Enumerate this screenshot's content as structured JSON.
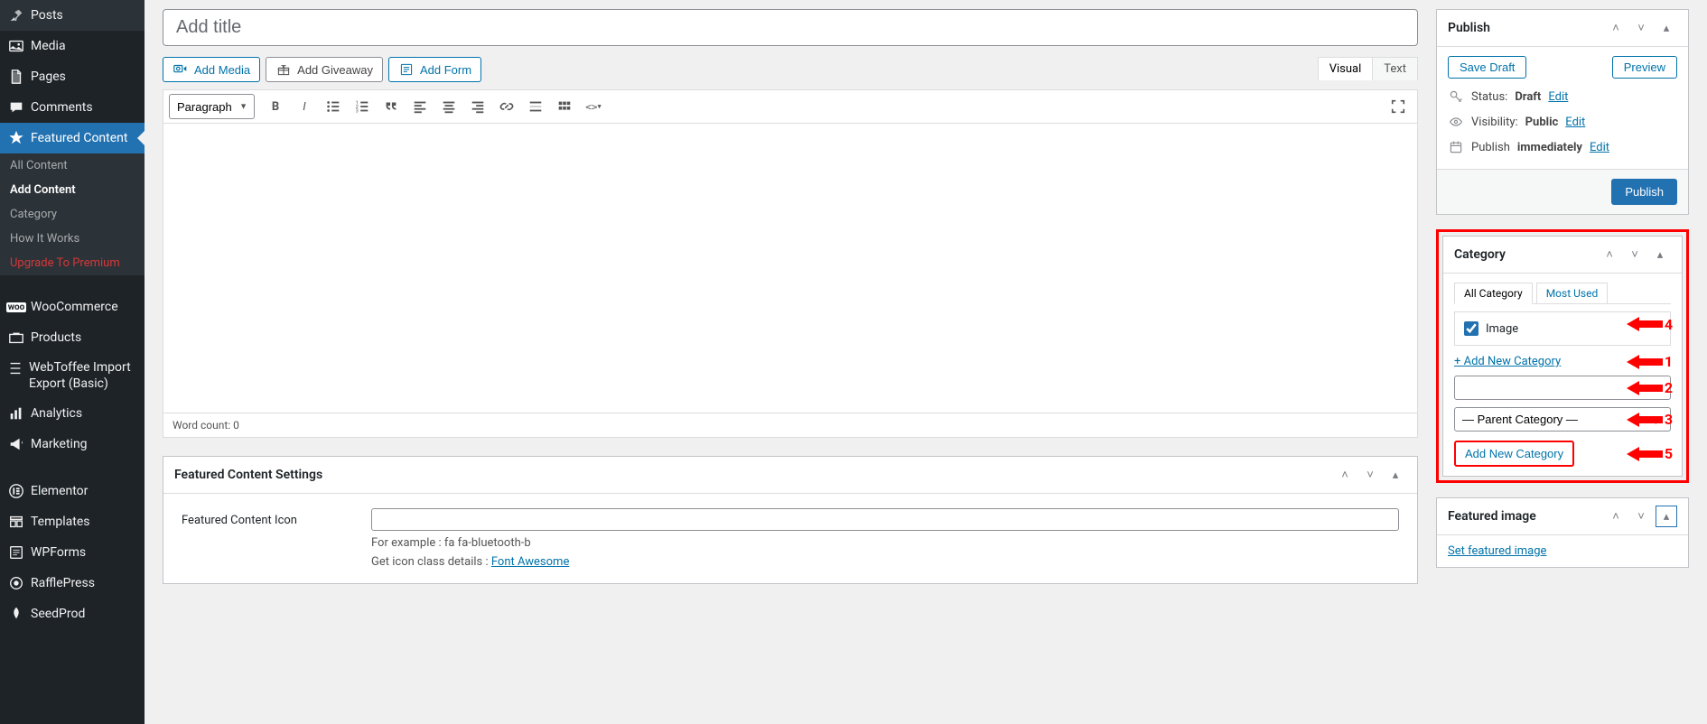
{
  "sidebar": {
    "items": [
      {
        "icon": "pin",
        "label": "Posts"
      },
      {
        "icon": "media",
        "label": "Media"
      },
      {
        "icon": "page",
        "label": "Pages"
      },
      {
        "icon": "comment",
        "label": "Comments"
      },
      {
        "icon": "star",
        "label": "Featured Content",
        "active": true
      },
      {
        "icon": "cart",
        "label": "WooCommerce"
      },
      {
        "icon": "tag",
        "label": "Products"
      },
      {
        "icon": "export",
        "label": "WebToffee Import Export (Basic)"
      },
      {
        "icon": "chart",
        "label": "Analytics"
      },
      {
        "icon": "megaphone",
        "label": "Marketing"
      },
      {
        "icon": "elementor",
        "label": "Elementor"
      },
      {
        "icon": "templates",
        "label": "Templates"
      },
      {
        "icon": "forms",
        "label": "WPForms"
      },
      {
        "icon": "raffle",
        "label": "RafflePress"
      },
      {
        "icon": "seed",
        "label": "SeedProd"
      }
    ],
    "subitems": [
      {
        "label": "All Content"
      },
      {
        "label": "Add Content",
        "current": true
      },
      {
        "label": "Category"
      },
      {
        "label": "How It Works"
      },
      {
        "label": "Upgrade To Premium",
        "premium": true
      }
    ]
  },
  "editor": {
    "title_placeholder": "Add title",
    "add_media": "Add Media",
    "add_giveaway": "Add Giveaway",
    "add_form": "Add Form",
    "tab_visual": "Visual",
    "tab_text": "Text",
    "format": "Paragraph",
    "word_count": "Word count: 0"
  },
  "publish": {
    "title": "Publish",
    "save_draft": "Save Draft",
    "preview": "Preview",
    "status_label": "Status:",
    "status_value": "Draft",
    "visibility_label": "Visibility:",
    "visibility_value": "Public",
    "publish_label": "Publish",
    "publish_value": "immediately",
    "edit": "Edit",
    "submit": "Publish"
  },
  "category": {
    "title": "Category",
    "tab_all": "All Category",
    "tab_most": "Most Used",
    "item_image": "Image",
    "add_new_link": "+ Add New Category",
    "parent_placeholder": "— Parent Category —",
    "add_new_button": "Add New Category"
  },
  "featured_image": {
    "title": "Featured image",
    "link": "Set featured image"
  },
  "fc_settings": {
    "title": "Featured Content Settings",
    "icon_label": "Featured Content Icon",
    "help1": "For example : fa fa-bluetooth-b",
    "help2_prefix": "Get icon class details : ",
    "help2_link": "Font Awesome"
  },
  "annotations": {
    "a1": "1",
    "a2": "2",
    "a3": "3",
    "a4": "4",
    "a5": "5"
  }
}
